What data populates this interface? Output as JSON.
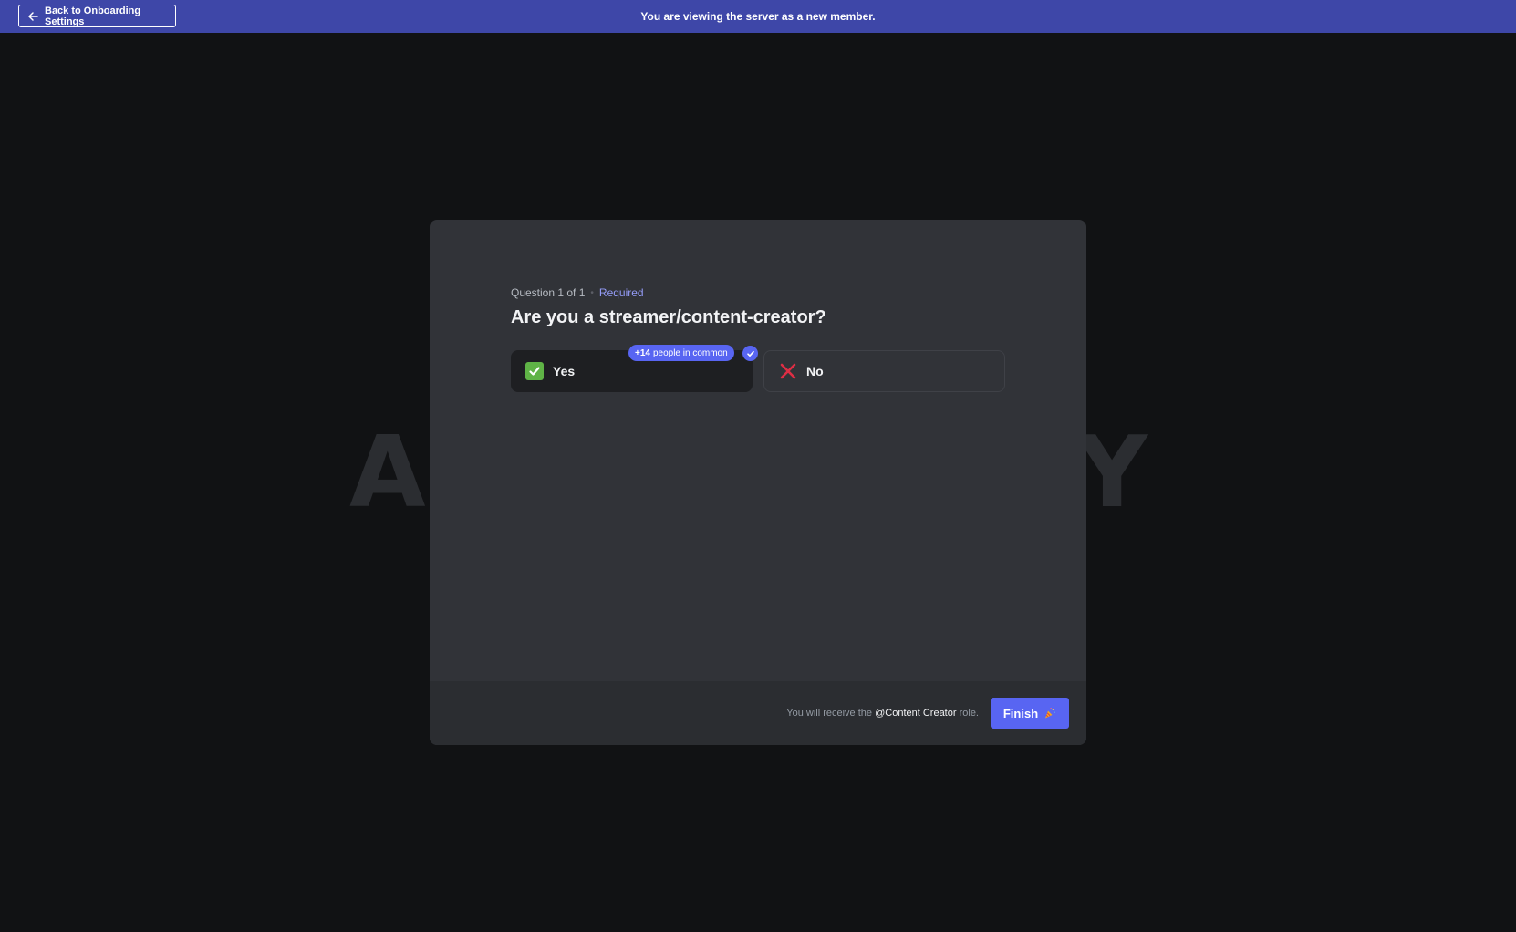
{
  "topbar": {
    "back_label": "Back to Onboarding Settings",
    "message": "You are viewing the server as a new member."
  },
  "background": {
    "left_text": "A",
    "right_text": "Y"
  },
  "question": {
    "counter": "Question 1 of 1",
    "separator": "•",
    "required_label": "Required",
    "title": "Are you a streamer/content-creator?",
    "options": [
      {
        "label": "Yes",
        "icon": "check-mark-emoji-icon",
        "selected": true,
        "badge_count": "+14",
        "badge_text": "people in common"
      },
      {
        "label": "No",
        "icon": "cross-mark-emoji-icon",
        "selected": false
      }
    ]
  },
  "footer": {
    "note_prefix": "You will receive the",
    "role": "@Content Creator",
    "note_suffix": "role.",
    "finish_label": "Finish",
    "finish_icon": "party-popper-icon"
  },
  "colors": {
    "accent": "#5865f2",
    "topbar": "#3e47a8",
    "required": "#949cf7"
  }
}
